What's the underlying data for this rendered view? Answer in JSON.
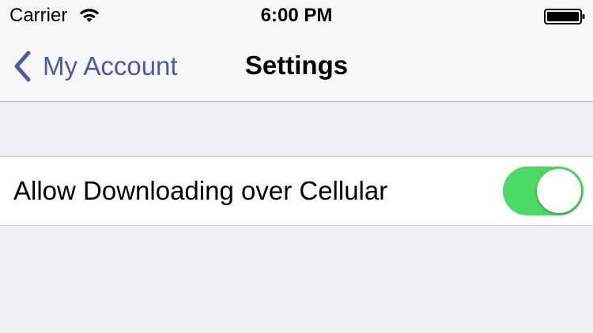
{
  "status_bar": {
    "carrier": "Carrier",
    "time": "6:00 PM",
    "wifi_icon": "wifi-icon",
    "battery_icon": "battery-icon"
  },
  "nav_bar": {
    "back_label": "My Account",
    "back_icon": "chevron-left-icon",
    "title": "Settings"
  },
  "settings": {
    "rows": [
      {
        "label": "Allow Downloading over Cellular",
        "toggle_on": true
      }
    ]
  },
  "colors": {
    "tint": "#5156a5",
    "toggle_on": "#4cd964",
    "background": "#efeff4"
  }
}
